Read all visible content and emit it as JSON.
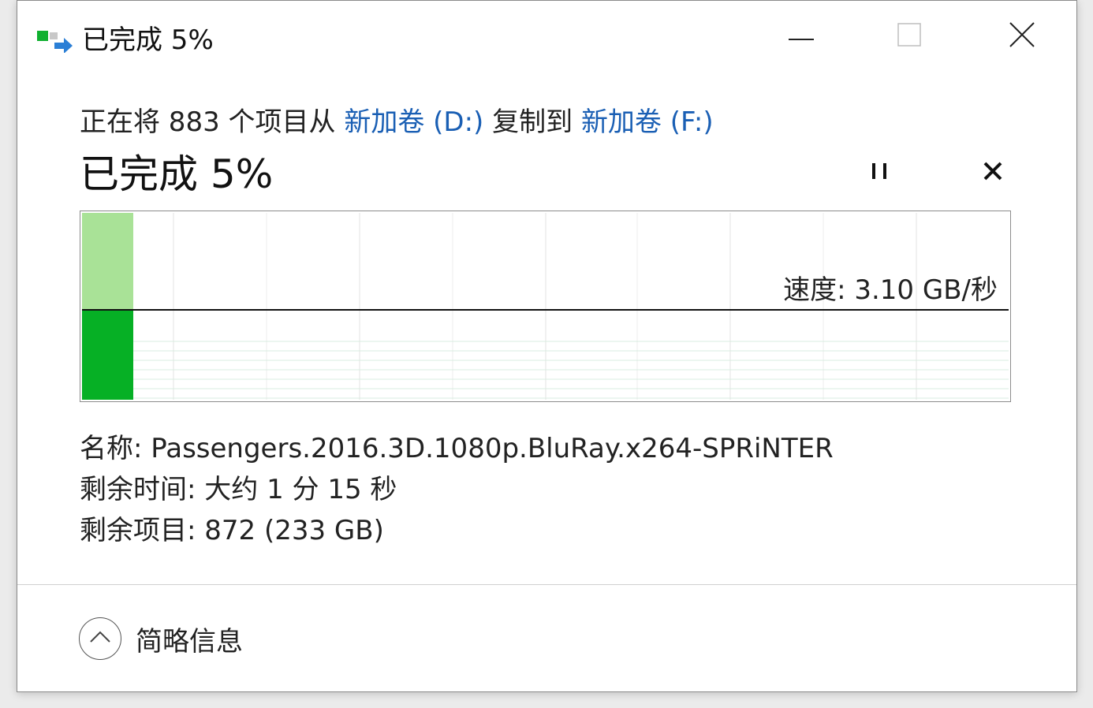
{
  "window": {
    "title": "已完成 5%"
  },
  "summary": {
    "prefix": "正在将 883 个项目从 ",
    "source": "新加卷 (D:)",
    "middle": " 复制到 ",
    "destination": "新加卷 (F:)"
  },
  "progress": {
    "label": "已完成 5%",
    "percent": 5
  },
  "graph": {
    "speed_label": "速度: 3.10 GB/秒"
  },
  "details": {
    "name_label": "名称: ",
    "name_value": "Passengers.2016.3D.1080p.BluRay.x264-SPRiNTER",
    "time_label": "剩余时间: ",
    "time_value": "大约 1 分 15 秒",
    "items_label": "剩余项目: ",
    "items_value": "872 (233 GB)"
  },
  "footer": {
    "fewer_details_label": "简略信息"
  },
  "colors": {
    "link": "#1a5fb4",
    "progress_light": "#a9e297",
    "progress_dark": "#06b025",
    "grid_line": "#d9ede0"
  },
  "icons": {
    "app": "file-copy-icon",
    "minimize": "minimize-icon",
    "maximize": "maximize-icon",
    "close": "close-icon",
    "pause": "pause-icon",
    "cancel": "cancel-icon",
    "collapse": "chevron-up-icon"
  }
}
